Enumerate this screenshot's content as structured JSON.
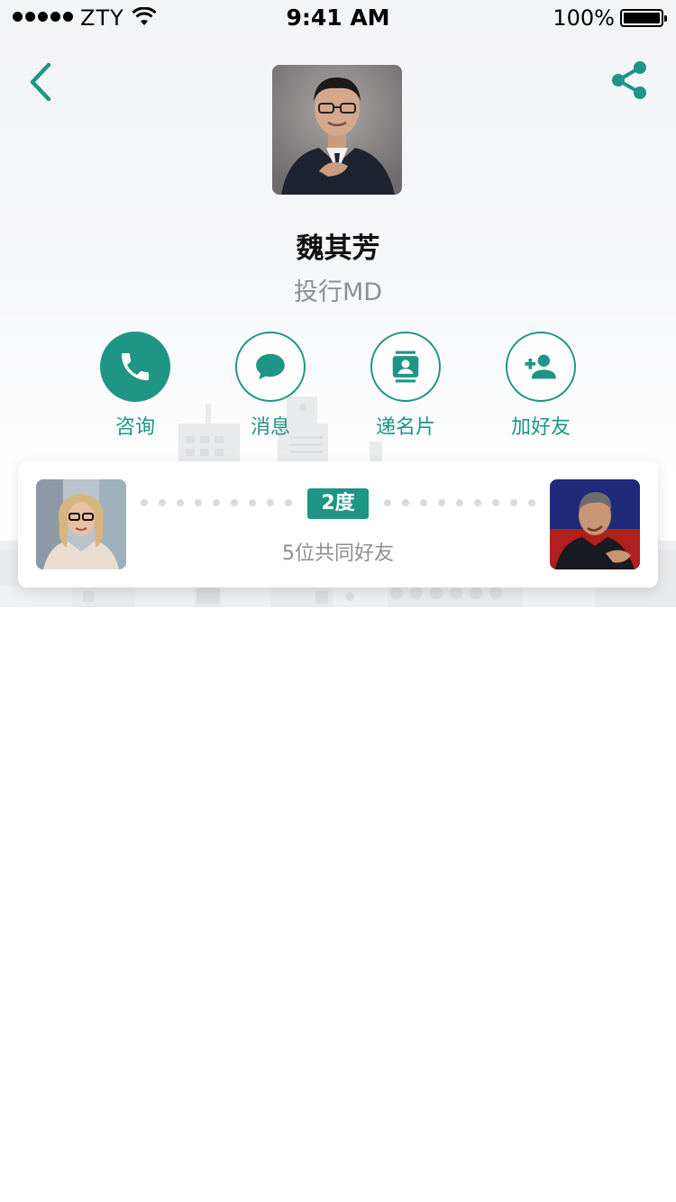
{
  "status_bar": {
    "carrier": "ZTY",
    "time": "9:41 AM",
    "battery": "100%"
  },
  "nav": {
    "back_icon": "chevron-left-icon",
    "share_icon": "share-icon"
  },
  "profile": {
    "name": "魏其芳",
    "title": "投行MD"
  },
  "actions": [
    {
      "label": "咨询",
      "icon": "phone-icon",
      "style": "solid"
    },
    {
      "label": "消息",
      "icon": "chat-bubble-icon",
      "style": "outline"
    },
    {
      "label": "递名片",
      "icon": "contact-card-icon",
      "style": "outline"
    },
    {
      "label": "加好友",
      "icon": "add-friend-icon",
      "style": "outline"
    }
  ],
  "connection": {
    "degree": "2度",
    "mutual_friends": "5位共同好友"
  },
  "colors": {
    "accent": "#1f9585",
    "secondary_text": "#8e8e93"
  }
}
